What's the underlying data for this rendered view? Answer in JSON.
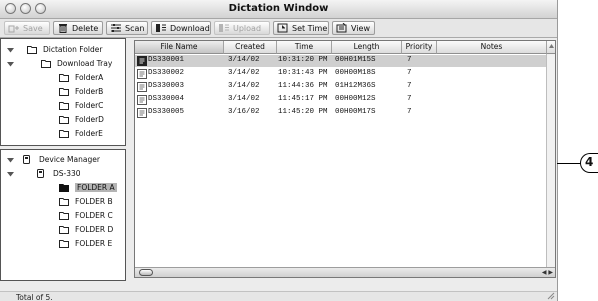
{
  "window": {
    "title": "Dictation Window"
  },
  "toolbar": {
    "save": "Save",
    "delete": "Delete",
    "scan": "Scan",
    "download": "Download",
    "upload": "Upload",
    "set_time": "Set Time",
    "view": "View"
  },
  "dictation_tree": {
    "root": "Dictation Folder",
    "tray": "Download Tray",
    "folders": [
      "FolderA",
      "FolderB",
      "FolderC",
      "FolderD",
      "FolderE"
    ]
  },
  "device_tree": {
    "root": "Device Manager",
    "device": "DS-330",
    "folders": [
      "FOLDER A",
      "FOLDER B",
      "FOLDER C",
      "FOLDER D",
      "FOLDER E"
    ],
    "selected_folder": "FOLDER A"
  },
  "file_list": {
    "columns": [
      "File Name",
      "Created",
      "Time",
      "Length",
      "Priority",
      "Notes"
    ],
    "sorted_column": "File Name",
    "selected_row": 0,
    "rows": [
      {
        "name": "DS330001",
        "created": "3/14/02",
        "time": "10:31:20 PM",
        "length": "00H01M15S",
        "priority": "7"
      },
      {
        "name": "DS330002",
        "created": "3/14/02",
        "time": "10:31:43 PM",
        "length": "00H00M18S",
        "priority": "7"
      },
      {
        "name": "DS330003",
        "created": "3/14/02",
        "time": "11:44:36 PM",
        "length": "01H12M36S",
        "priority": "7"
      },
      {
        "name": "DS330004",
        "created": "3/14/02",
        "time": "11:45:17 PM",
        "length": "00H00M12S",
        "priority": "7"
      },
      {
        "name": "DS330005",
        "created": "3/16/02",
        "time": "11:45:20 PM",
        "length": "00H00M17S",
        "priority": "7"
      }
    ]
  },
  "status": {
    "text": "Total of 5."
  },
  "callout": {
    "label": "4"
  },
  "colors": {
    "selection": "#cfcfcf",
    "folder_selected": "#111111",
    "window_bg": "#ececec"
  }
}
